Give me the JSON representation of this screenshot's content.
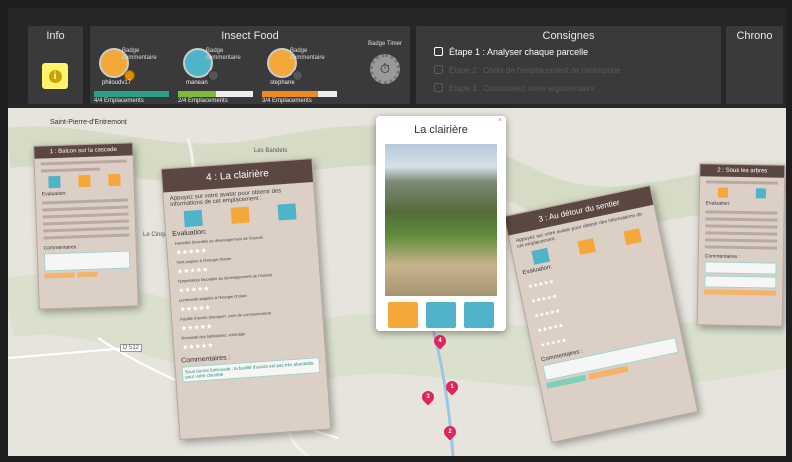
{
  "info_panel": {
    "title": "Info"
  },
  "team_panel": {
    "title": "Insect Food",
    "players": [
      {
        "badge_label": "Badge commentaire",
        "name": "philoudv17",
        "count": "4/4 Emplacements",
        "progress": 1.0,
        "bar_color": "#2aa089",
        "avatar_color": "#f4a83a"
      },
      {
        "badge_label": "Badge commentaire",
        "name": "manean",
        "count": "2/4 Emplacements",
        "progress": 0.5,
        "bar_color": "#7dbb3a",
        "avatar_color": "#4fb3c9"
      },
      {
        "badge_label": "Badge commentaire",
        "name": "stephane",
        "count": "3/4 Emplacements",
        "progress": 0.75,
        "bar_color": "#f08a1c",
        "avatar_color": "#f4a83a"
      }
    ],
    "timer_badge_label": "Badge Timer"
  },
  "consignes": {
    "title": "Consignes",
    "steps": [
      {
        "label": "Étape 1 : Analyser chaque parcelle",
        "active": true
      },
      {
        "label": "Étape 2 : Choix de l'emplacement de l'entreprise",
        "active": false
      },
      {
        "label": "Étape 3 : Construisez votre argumentaire",
        "active": false
      }
    ]
  },
  "chrono": {
    "title": "Chrono"
  },
  "map": {
    "labels": [
      "Saint-Pierre-d'Entremont",
      "Les Bandets",
      "D 512",
      "Le Cinquin"
    ],
    "markers": [
      "4",
      "1",
      "3",
      "2"
    ]
  },
  "cards": {
    "card1": {
      "title": "1 : Balcon sur la cascade",
      "eval": "Evaluation:",
      "comments_title": "Commentaires :"
    },
    "card4": {
      "title": "4 : La clairière",
      "instruction": "Appuyez sur votre avatar pour obtenir des informations de cet emplacement :",
      "eval": "Evaluation:",
      "criteria": [
        "Humidité favorable au développement de l'insecte",
        "Vent propice à l'énergie choisie",
        "Température favorable au développement de l'insecte",
        "Luminosité adaptée à l'énergie choisie",
        "Facilité d'accès (transport, zone de communication)",
        "Proximité des habitations, voisinage"
      ],
      "comments_title": "Commentaires :",
      "comment": "Sous bonne luminosité : la facilité d'accès est pas très abordable pour votre clientèle"
    },
    "card3": {
      "title": "3 : Au détour du sentier",
      "instruction": "Appuyez sur votre avatar pour obtenir des informations de cet emplacement :",
      "eval": "Evaluation:",
      "comments_title": "Commentaires :"
    },
    "card2": {
      "title": "2 : Sous les arbres",
      "eval": "Evaluation:",
      "comments_title": "Commentaires :"
    }
  },
  "popup": {
    "title": "La clairière",
    "close": "×"
  }
}
